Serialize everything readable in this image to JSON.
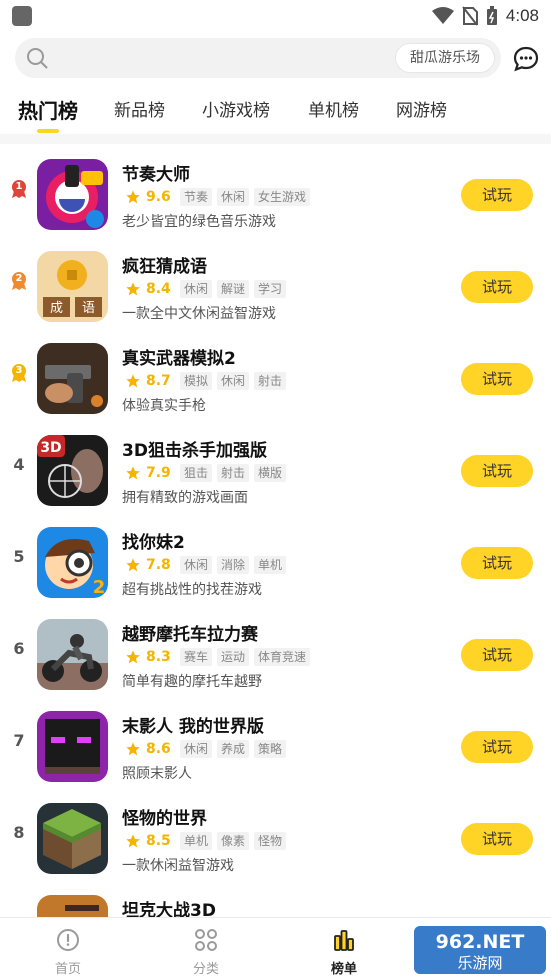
{
  "status_bar": {
    "time": "4:08"
  },
  "search": {
    "placeholder": "",
    "chip_label": "甜瓜游乐场"
  },
  "tabs": [
    {
      "label": "热门榜",
      "active": true
    },
    {
      "label": "新品榜",
      "active": false
    },
    {
      "label": "小游戏榜",
      "active": false
    },
    {
      "label": "单机榜",
      "active": false
    },
    {
      "label": "网游榜",
      "active": false
    }
  ],
  "games": [
    {
      "rank": "1",
      "name": "节奏大师",
      "score": "9.6",
      "tags": [
        "节奏",
        "休闲",
        "女生游戏"
      ],
      "desc": "老少皆宜的绿色音乐游戏",
      "button": "试玩",
      "icon": "music-game-icon"
    },
    {
      "rank": "2",
      "name": "疯狂猜成语",
      "score": "8.4",
      "tags": [
        "休闲",
        "解谜",
        "学习"
      ],
      "desc": "一款全中文休闲益智游戏",
      "button": "试玩",
      "icon": "coin-idiom-icon"
    },
    {
      "rank": "3",
      "name": "真实武器模拟2",
      "score": "8.7",
      "tags": [
        "模拟",
        "休闲",
        "射击"
      ],
      "desc": "体验真实手枪",
      "button": "试玩",
      "icon": "pistol-icon"
    },
    {
      "rank": "4",
      "name": "3D狙击杀手加强版",
      "score": "7.9",
      "tags": [
        "狙击",
        "射击",
        "横版"
      ],
      "desc": "拥有精致的游戏画面",
      "button": "试玩",
      "icon": "sniper-icon"
    },
    {
      "rank": "5",
      "name": "找你妹2",
      "score": "7.8",
      "tags": [
        "休闲",
        "消除",
        "单机"
      ],
      "desc": "超有挑战性的找茬游戏",
      "button": "试玩",
      "icon": "magnifier-boy-icon"
    },
    {
      "rank": "6",
      "name": "越野摩托车拉力赛",
      "score": "8.3",
      "tags": [
        "赛车",
        "运动",
        "体育竞速"
      ],
      "desc": "简单有趣的摩托车越野",
      "button": "试玩",
      "icon": "motorbike-icon"
    },
    {
      "rank": "7",
      "name": "末影人 我的世界版",
      "score": "8.6",
      "tags": [
        "休闲",
        "养成",
        "策略"
      ],
      "desc": "照顾末影人",
      "button": "试玩",
      "icon": "enderman-icon"
    },
    {
      "rank": "8",
      "name": "怪物的世界",
      "score": "8.5",
      "tags": [
        "单机",
        "像素",
        "怪物"
      ],
      "desc": "一款休闲益智游戏",
      "button": "试玩",
      "icon": "grass-block-icon"
    },
    {
      "rank": "",
      "name": "坦克大战3D",
      "score": "",
      "tags": [],
      "desc": "",
      "button": "",
      "icon": "tank-icon"
    }
  ],
  "bottom_nav": [
    {
      "label": "首页",
      "icon": "home-icon",
      "active": false
    },
    {
      "label": "分类",
      "icon": "category-icon",
      "active": false
    },
    {
      "label": "榜单",
      "icon": "ranking-icon",
      "active": true
    },
    {
      "label": "",
      "icon": "",
      "active": false
    }
  ],
  "watermark": {
    "top": "962.NET",
    "bottom": "乐游网"
  },
  "colors": {
    "accent": "#ffd426",
    "score": "#f4b400",
    "medal_gold": "#e0433a",
    "medal_silver": "#f08a2e",
    "medal_bronze": "#f4b400"
  }
}
